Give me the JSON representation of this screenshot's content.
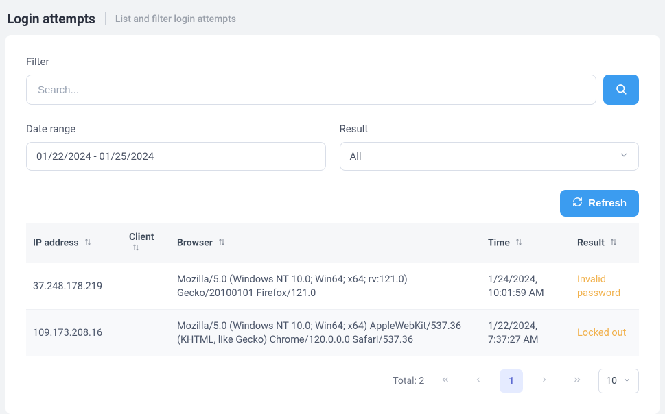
{
  "header": {
    "title": "Login attempts",
    "subtitle": "List and filter login attempts"
  },
  "filter": {
    "label": "Filter",
    "search_placeholder": "Search...",
    "search_value": ""
  },
  "date_range": {
    "label": "Date range",
    "value": "01/22/2024 - 01/25/2024"
  },
  "result_filter": {
    "label": "Result",
    "value": "All"
  },
  "toolbar": {
    "refresh_label": "Refresh"
  },
  "columns": {
    "ip": "IP address",
    "client": "Client",
    "browser": "Browser",
    "time": "Time",
    "result": "Result"
  },
  "rows": [
    {
      "ip": "37.248.178.219",
      "client": "",
      "browser": "Mozilla/5.0 (Windows NT 10.0; Win64; x64; rv:121.0) Gecko/20100101 Firefox/121.0",
      "time": "1/24/2024, 10:01:59 AM",
      "result": "Invalid password"
    },
    {
      "ip": "109.173.208.16",
      "client": "",
      "browser": "Mozilla/5.0 (Windows NT 10.0; Win64; x64) AppleWebKit/537.36 (KHTML, like Gecko) Chrome/120.0.0.0 Safari/537.36",
      "time": "1/22/2024, 7:37:27 AM",
      "result": "Locked out"
    }
  ],
  "paginator": {
    "total_label": "Total: 2",
    "current_page": "1",
    "page_size": "10"
  }
}
